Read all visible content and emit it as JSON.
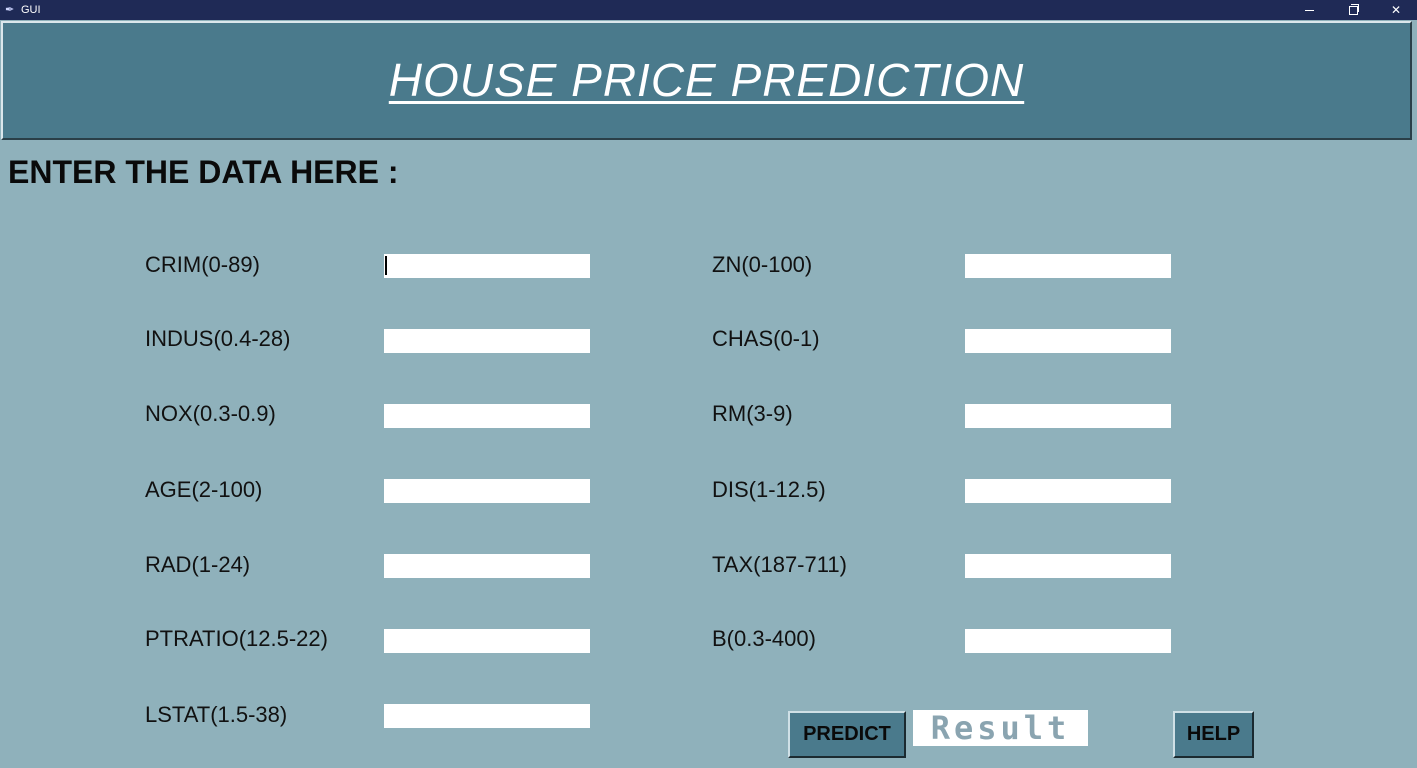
{
  "window": {
    "title": "GUI",
    "icon": "feather-icon",
    "controls": [
      "minimize",
      "restore",
      "close"
    ]
  },
  "header": {
    "title": "HOUSE PRICE PREDICTION"
  },
  "form": {
    "heading": "ENTER THE DATA HERE :",
    "fields": [
      {
        "label": "CRIM(0-89)",
        "value": ""
      },
      {
        "label": "ZN(0-100)",
        "value": ""
      },
      {
        "label": "INDUS(0.4-28)",
        "value": ""
      },
      {
        "label": "CHAS(0-1)",
        "value": ""
      },
      {
        "label": "NOX(0.3-0.9)",
        "value": ""
      },
      {
        "label": "RM(3-9)",
        "value": ""
      },
      {
        "label": "AGE(2-100)",
        "value": ""
      },
      {
        "label": "DIS(1-12.5)",
        "value": ""
      },
      {
        "label": "RAD(1-24)",
        "value": ""
      },
      {
        "label": "TAX(187-711)",
        "value": ""
      },
      {
        "label": "PTRATIO(12.5-22)",
        "value": ""
      },
      {
        "label": "B(0.3-400)",
        "value": ""
      },
      {
        "label": "LSTAT(1.5-38)",
        "value": ""
      }
    ]
  },
  "actions": {
    "predict_label": "PREDICT",
    "result_text": "Result",
    "help_label": "HELP"
  },
  "colors": {
    "background": "#8fb1bb",
    "header": "#4a7a8c",
    "titlebar": "#1f2a56",
    "button": "#4a7a8c"
  }
}
